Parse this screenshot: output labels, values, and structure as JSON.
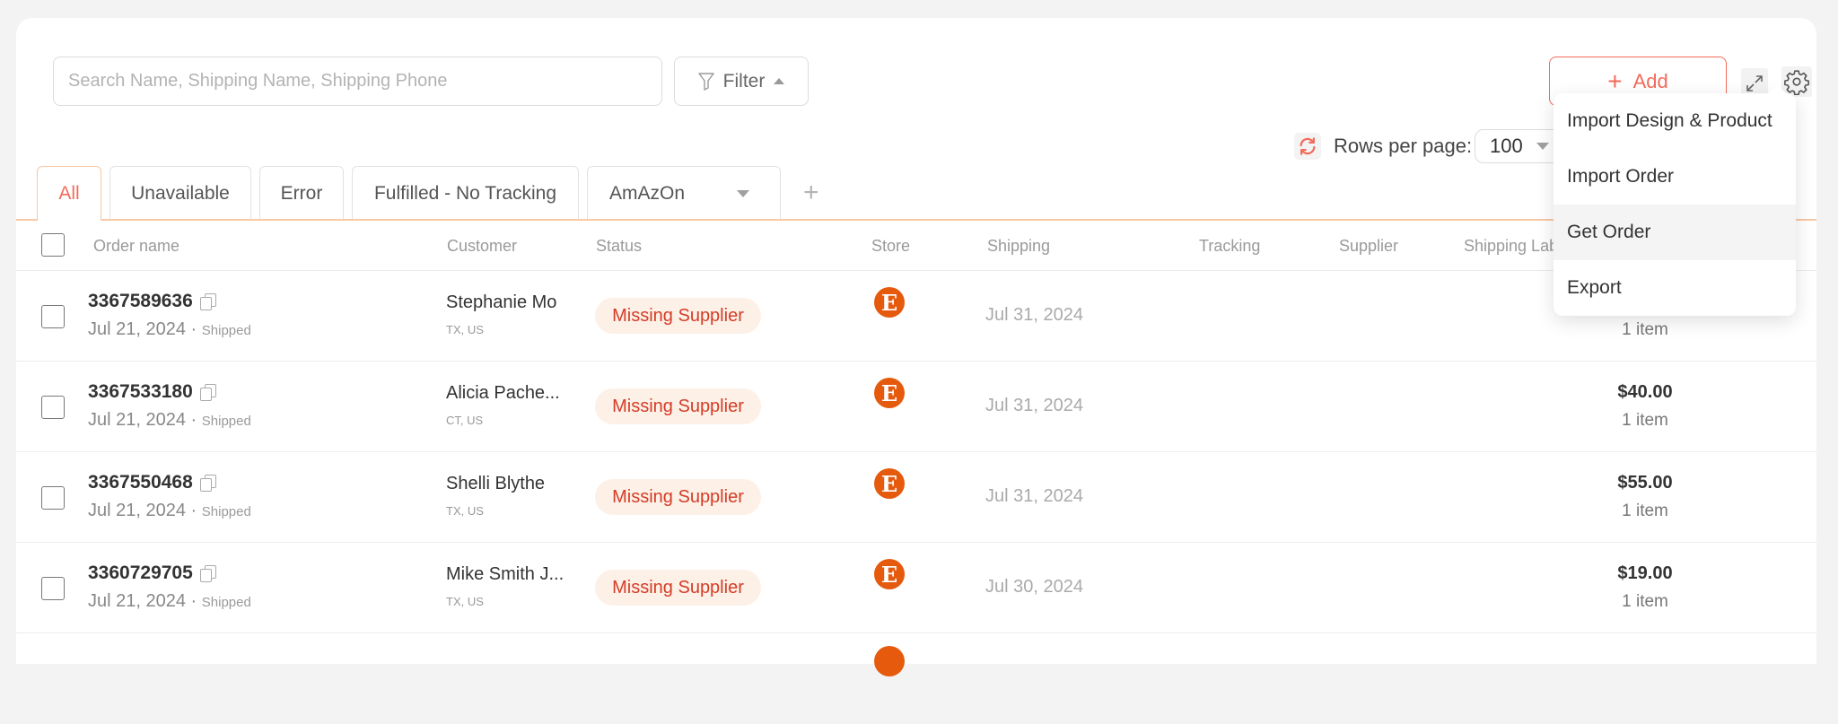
{
  "toolbar": {
    "search_placeholder": "Search Name, Shipping Name, Shipping Phone",
    "search_value": "",
    "filter_label": "Filter",
    "add_label": "Add",
    "rows_per_page_label": "Rows per page:",
    "rows_per_page_value": "100"
  },
  "tabs": [
    {
      "label": "All",
      "active": true
    },
    {
      "label": "Unavailable",
      "active": false
    },
    {
      "label": "Error",
      "active": false
    },
    {
      "label": "Fulfilled - No Tracking",
      "active": false
    },
    {
      "label": "AmAzOn",
      "active": false,
      "dropdown": true
    }
  ],
  "table": {
    "columns": [
      "Order name",
      "Customer",
      "Status",
      "Store",
      "Shipping",
      "Tracking",
      "Supplier",
      "Shipping Label"
    ],
    "rows": [
      {
        "order": "3367589636",
        "date": "Jul 21, 2024",
        "fulfillment": "Shipped",
        "customer": "Stephanie Mo",
        "location": "TX, US",
        "status": "Missing Supplier",
        "store": "E",
        "shipping": "Jul 31, 2024",
        "price": "",
        "items": "1 item"
      },
      {
        "order": "3367533180",
        "date": "Jul 21, 2024",
        "fulfillment": "Shipped",
        "customer": "Alicia Pache...",
        "location": "CT, US",
        "status": "Missing Supplier",
        "store": "E",
        "shipping": "Jul 31, 2024",
        "price": "$40.00",
        "items": "1 item"
      },
      {
        "order": "3367550468",
        "date": "Jul 21, 2024",
        "fulfillment": "Shipped",
        "customer": "Shelli Blythe",
        "location": "TX, US",
        "status": "Missing Supplier",
        "store": "E",
        "shipping": "Jul 31, 2024",
        "price": "$55.00",
        "items": "1 item"
      },
      {
        "order": "3360729705",
        "date": "Jul 21, 2024",
        "fulfillment": "Shipped",
        "customer": "Mike Smith J...",
        "location": "TX, US",
        "status": "Missing Supplier",
        "store": "E",
        "shipping": "Jul 30, 2024",
        "price": "$19.00",
        "items": "1 item"
      }
    ]
  },
  "settings_menu": {
    "items": [
      "Import Design & Product",
      "Import Order",
      "Get Order",
      "Export"
    ],
    "highlighted": "Get Order"
  },
  "colors": {
    "accent": "#f26b5b",
    "status_badge_bg": "#fdf0e6",
    "status_badge_text": "#d43d28",
    "etsy": "#e55a0d"
  }
}
